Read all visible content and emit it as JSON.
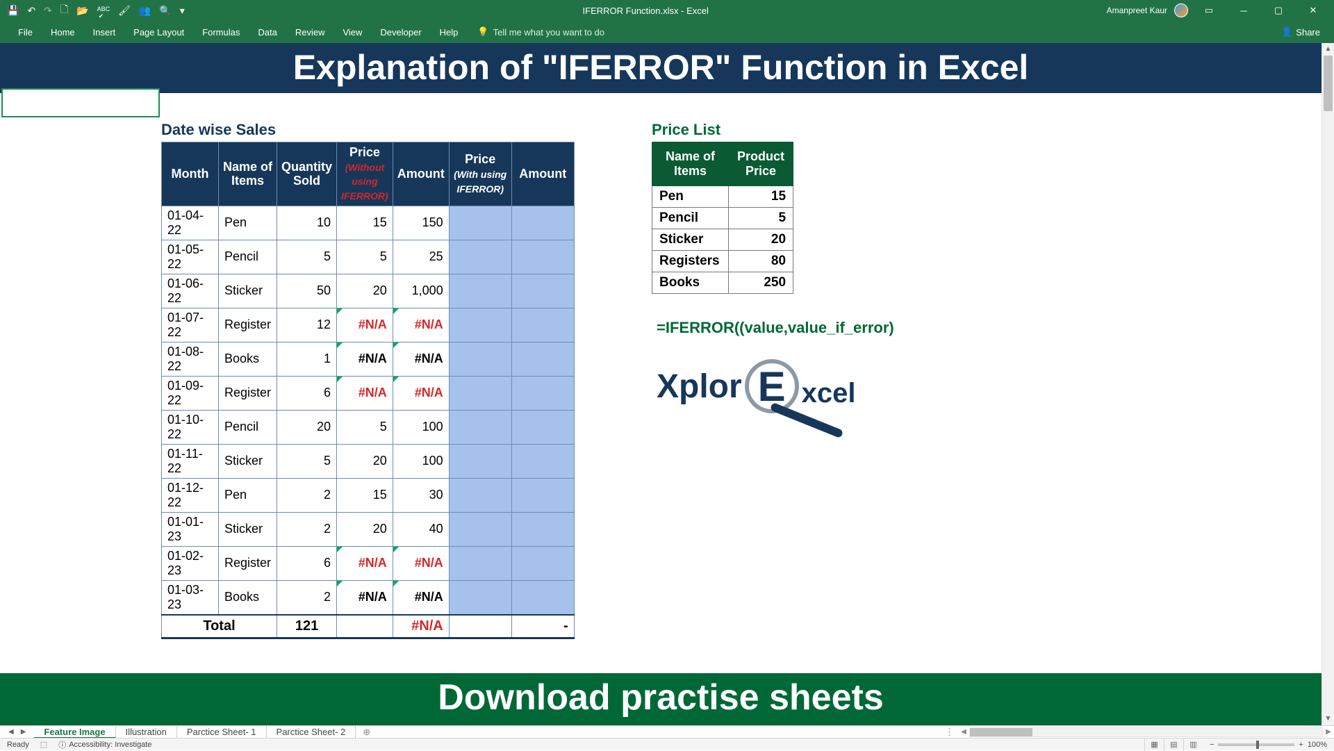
{
  "title_bar": {
    "doc_title": "IFERROR Function.xlsx",
    "app_name": "Excel",
    "separator": "  -  ",
    "user": "Amanpreet Kaur"
  },
  "qat": {
    "save": "💾",
    "undo": "↶",
    "redo": "↷",
    "new": "🗋",
    "open": "📂",
    "spell": "ABC",
    "format_painter": "🖌",
    "share_ext": "👥",
    "preview": "🔍",
    "more": "▾"
  },
  "ribbon": {
    "tabs": [
      "File",
      "Home",
      "Insert",
      "Page Layout",
      "Formulas",
      "Data",
      "Review",
      "View",
      "Developer",
      "Help"
    ],
    "tell_me": "Tell me what you want to do",
    "share": "Share"
  },
  "banners": {
    "top": "Explanation of \"IFERROR\" Function in Excel",
    "bottom": "Download practise sheets"
  },
  "sales_title": "Date wise Sales",
  "sales_headers": {
    "month": "Month",
    "name": "Name of Items",
    "qty": "Quantity Sold",
    "price1_a": "Price",
    "price1_b": "(Without using IFERROR)",
    "amount1": "Amount",
    "price2_a": "Price",
    "price2_b": "(With using IFERROR)",
    "amount2": "Amount"
  },
  "sales_rows": [
    {
      "month": "01-04-22",
      "item": "Pen",
      "qty": "10",
      "p1": "15",
      "a1": "150"
    },
    {
      "month": "01-05-22",
      "item": "Pencil",
      "qty": "5",
      "p1": "5",
      "a1": "25"
    },
    {
      "month": "01-06-22",
      "item": "Sticker",
      "qty": "50",
      "p1": "20",
      "a1": "1,000"
    },
    {
      "month": "01-07-22",
      "item": "Register",
      "qty": "12",
      "p1": "#N/A",
      "a1": "#N/A",
      "err": "red"
    },
    {
      "month": "01-08-22",
      "item": "Books",
      "qty": "1",
      "p1": "#N/A",
      "a1": "#N/A",
      "err": "blk"
    },
    {
      "month": "01-09-22",
      "item": "Register",
      "qty": "6",
      "p1": "#N/A",
      "a1": "#N/A",
      "err": "red"
    },
    {
      "month": "01-10-22",
      "item": "Pencil",
      "qty": "20",
      "p1": "5",
      "a1": "100"
    },
    {
      "month": "01-11-22",
      "item": "Sticker",
      "qty": "5",
      "p1": "20",
      "a1": "100"
    },
    {
      "month": "01-12-22",
      "item": "Pen",
      "qty": "2",
      "p1": "15",
      "a1": "30"
    },
    {
      "month": "01-01-23",
      "item": "Sticker",
      "qty": "2",
      "p1": "20",
      "a1": "40"
    },
    {
      "month": "01-02-23",
      "item": "Register",
      "qty": "6",
      "p1": "#N/A",
      "a1": "#N/A",
      "err": "red"
    },
    {
      "month": "01-03-23",
      "item": "Books",
      "qty": "2",
      "p1": "#N/A",
      "a1": "#N/A",
      "err": "blk"
    }
  ],
  "sales_total": {
    "label": "Total",
    "qty": "121",
    "amount": "#N/A",
    "dash": "-"
  },
  "price_title": "Price List",
  "price_headers": {
    "name": "Name of Items",
    "price": "Product Price"
  },
  "price_rows": [
    {
      "name": "Pen",
      "price": "15"
    },
    {
      "name": "Pencil",
      "price": "5"
    },
    {
      "name": "Sticker",
      "price": "20"
    },
    {
      "name": "Registers",
      "price": "80"
    },
    {
      "name": "Books",
      "price": "250"
    }
  ],
  "formula": "=IFERROR((value,value_if_error)",
  "logo": {
    "a": "Xplor",
    "b": "E",
    "c": "xcel"
  },
  "sheet_tabs": [
    "Feature Image",
    "Illustration",
    "Parctice Sheet- 1",
    "Parctice Sheet- 2"
  ],
  "status": {
    "ready": "Ready",
    "accessibility": "Accessibility: Investigate",
    "zoom": "100%",
    "minus": "−",
    "plus": "+"
  }
}
